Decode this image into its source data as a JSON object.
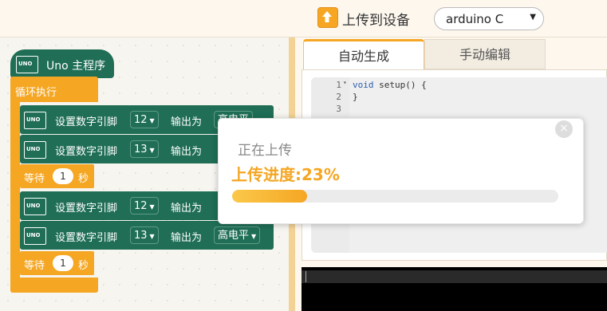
{
  "toolbar": {
    "upload_label": "上传到设备",
    "device_select": "arduino C"
  },
  "workspace": {
    "main_block": "Uno 主程序",
    "loop_label": "循环执行",
    "statements": [
      {
        "label": "设置数字引脚",
        "pin": "12",
        "output_label": "输出为",
        "level": "高电平"
      },
      {
        "label": "设置数字引脚",
        "pin": "13",
        "output_label": "输出为",
        "level": ""
      },
      {
        "label": "设置数字引脚",
        "pin": "12",
        "output_label": "输出为",
        "level": ""
      },
      {
        "label": "设置数字引脚",
        "pin": "13",
        "output_label": "输出为",
        "level": "高电平"
      }
    ],
    "waits": [
      {
        "label": "等待",
        "value": "1",
        "unit": "秒"
      },
      {
        "label": "等待",
        "value": "1",
        "unit": "秒"
      }
    ],
    "uno_text": "UNO"
  },
  "tabs": {
    "auto": "自动生成",
    "manual": "手动编辑"
  },
  "editor": {
    "lines": [
      {
        "num": "1",
        "keyword": "void",
        "text": " setup() {"
      },
      {
        "num": "2",
        "keyword": "",
        "text": "}"
      },
      {
        "num": "3",
        "keyword": "",
        "text": ""
      }
    ]
  },
  "modal": {
    "title": "正在上传",
    "progress_text": "上传进度:23%",
    "progress_fraction": 0.23,
    "close_symbol": "×"
  },
  "colors": {
    "accent": "#f5a623",
    "block_green": "#1f6e55"
  }
}
